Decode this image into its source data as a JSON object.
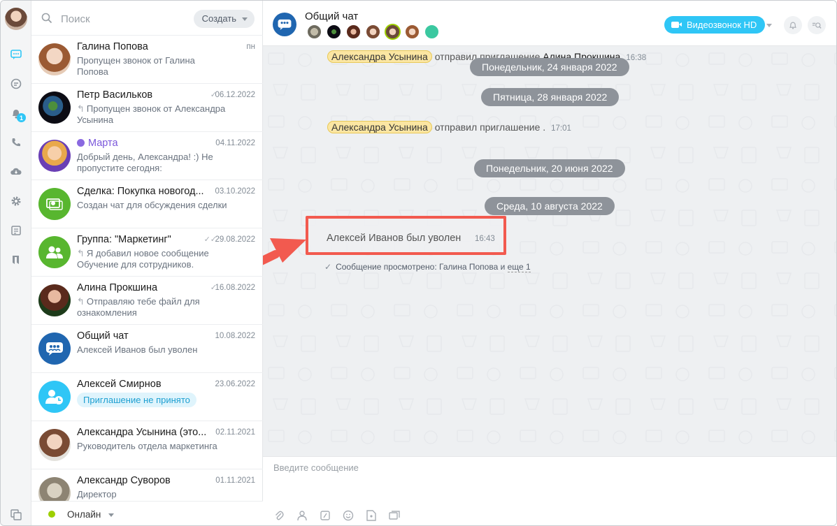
{
  "sidebar_rail": {
    "icons": [
      "chat-icon",
      "openlines-icon",
      "notifications-icon",
      "call-icon",
      "disk-icon",
      "settings-icon",
      "tasks-icon",
      "bookmarks-icon"
    ],
    "notification_count": "1"
  },
  "search": {
    "placeholder": "Поиск",
    "create_label": "Создать"
  },
  "chats": [
    {
      "name": "Галина Попова",
      "date": "пн",
      "sub": "Пропущен звонок от Галина Попова",
      "reply": false,
      "check": false
    },
    {
      "name": "Петр Васильков",
      "date": "06.12.2022",
      "sub": "Пропущен звонок от Александра Усынина",
      "reply": true,
      "check": true
    },
    {
      "name": "Марта",
      "date": "04.11.2022",
      "sub": "Добрый день, Александра! :) Не пропустите сегодня:",
      "reply": false,
      "check": false
    },
    {
      "name": "Сделка: Покупка новогод...",
      "date": "03.10.2022",
      "sub": "Создан чат для обсуждения сделки",
      "reply": false,
      "check": false
    },
    {
      "name": "Группа: \"Маркетинг\"",
      "date": "29.08.2022",
      "sub": "Я добавил новое сообщение Обучение для сотрудников.",
      "reply": true,
      "check": true
    },
    {
      "name": "Алина Прокшина",
      "date": "16.08.2022",
      "sub": "Отправляю тебе файл для ознакомления",
      "reply": true,
      "check": true
    },
    {
      "name": "Общий чат",
      "date": "10.08.2022",
      "sub": "Алексей Иванов был уволен",
      "reply": false,
      "check": false
    },
    {
      "name": "Алексей Смирнов",
      "date": "23.06.2022",
      "sub": "Приглашение не принято",
      "reply": false,
      "check": false
    },
    {
      "name": "Александра Усынина (это...",
      "date": "02.11.2021",
      "sub": "Руководитель отдела маркетинга",
      "reply": false,
      "check": false
    },
    {
      "name": "Александр Суворов",
      "date": "01.11.2021",
      "sub": "Директор",
      "reply": false,
      "check": false
    }
  ],
  "status": {
    "label": "Онлайн",
    "color": "#9dcf00"
  },
  "header": {
    "title": "Общий чат",
    "video_label": "Видеозвонок HD"
  },
  "messages": {
    "sys1": {
      "who": "Александра Усынина",
      "action": "отправил приглашение",
      "target": "Алина Прокшина",
      "time": "16:38"
    },
    "date1": "Понедельник, 24 января 2022",
    "date2": "Пятница, 28 января 2022",
    "sys2": {
      "who": "Александра Усынина",
      "action": "отправил приглашение .",
      "time": "17:01"
    },
    "date3": "Понедельник, 20 июня 2022",
    "date4": "Среда, 10 августа 2022",
    "highlight": {
      "text": "Алексей Иванов был уволен",
      "time": "16:43"
    },
    "seen": {
      "prefix": "Сообщение просмотрено: Галина Попова и",
      "more": "еще 1"
    }
  },
  "composer": {
    "placeholder": "Введите сообщение",
    "tools": [
      "attach-icon",
      "contact-icon",
      "document-icon",
      "smile-icon",
      "sticker-icon",
      "forward-icon"
    ]
  },
  "colors": {
    "accent": "#2fc6f6",
    "highlight_border": "#f25a4f",
    "date_pill": "#8e939a"
  }
}
